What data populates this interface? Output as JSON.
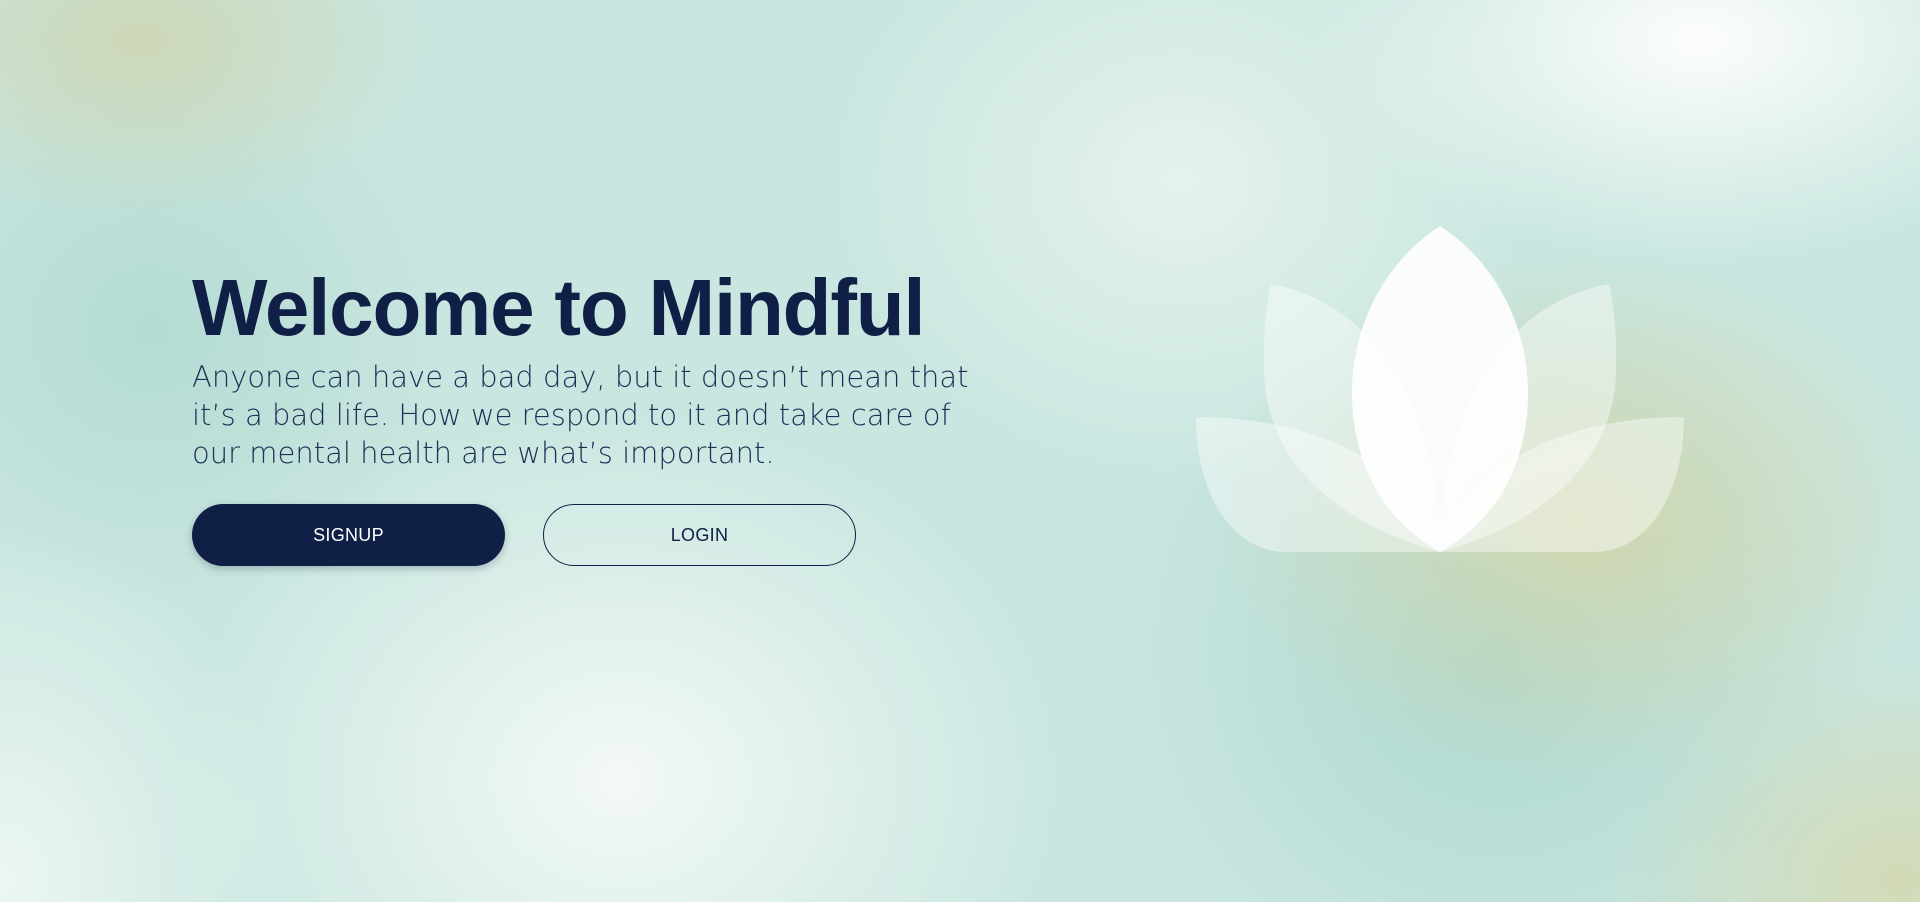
{
  "hero": {
    "title": "Welcome to Mindful",
    "text": "Anyone can have a bad day, but it doesn’t mean that it’s a bad life. How we respond to it and take care of our mental health are what’s important."
  },
  "actions": {
    "signup_label": "SIGNUP",
    "login_label": "LOGIN"
  },
  "illustration": {
    "icon": "lotus-icon"
  },
  "colors": {
    "primary": "#0f1f45",
    "background": "#c9e6e0",
    "accent_sand": "#d6d6a8",
    "lotus": "#ffffff"
  }
}
